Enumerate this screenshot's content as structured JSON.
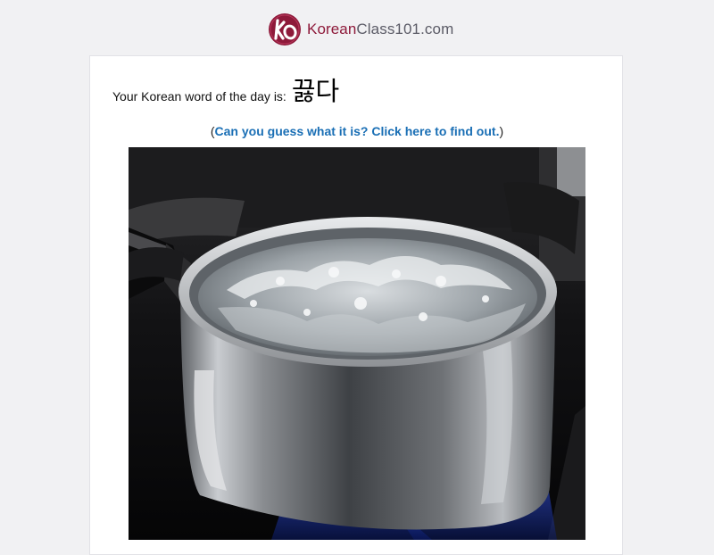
{
  "header": {
    "logo_korean": "Korean",
    "logo_rest": "Class101.com"
  },
  "card": {
    "intro_label": "Your Korean word of the day is:",
    "korean_word": "끓다",
    "guess_open_paren": "(",
    "guess_link_text": "Can you guess what it is? Click here to find out.",
    "guess_close_paren": ")"
  },
  "colors": {
    "brand": "#8e1a3a",
    "link": "#1a6fb5",
    "page_background": "#f1f1f3"
  },
  "photo": {
    "subject": "stainless steel pot of boiling water on a gas stove"
  }
}
